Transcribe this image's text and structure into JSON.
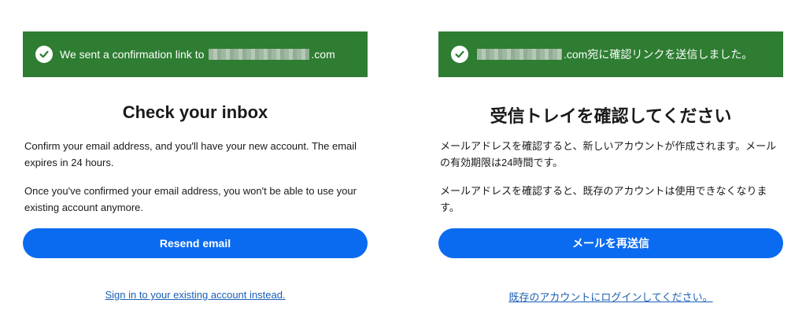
{
  "english": {
    "banner_prefix": "We sent a confirmation link to",
    "banner_suffix": ".com",
    "title": "Check your inbox",
    "paragraph1": "Confirm your email address, and you'll have your new account. The email expires in 24 hours.",
    "paragraph2": "Once you've confirmed your email address, you won't be able to use your existing account anymore.",
    "button_label": "Resend email",
    "link_text": "Sign in to your existing account instead."
  },
  "japanese": {
    "banner_suffix": ".com宛に確認リンクを送信しました。",
    "title": "受信トレイを確認してください",
    "paragraph1": "メールアドレスを確認すると、新しいアカウントが作成されます。メールの有効期限は24時間です。",
    "paragraph2": "メールアドレスを確認すると、既存のアカウントは使用できなくなります。",
    "button_label": "メールを再送信",
    "link_text": "既存のアカウントにログインしてください。"
  },
  "colors": {
    "banner": "#2e7d32",
    "button": "#0b6bf0",
    "link": "#1a5fb4"
  },
  "icons": {
    "banner_icon": "checkmark-circle-icon"
  }
}
